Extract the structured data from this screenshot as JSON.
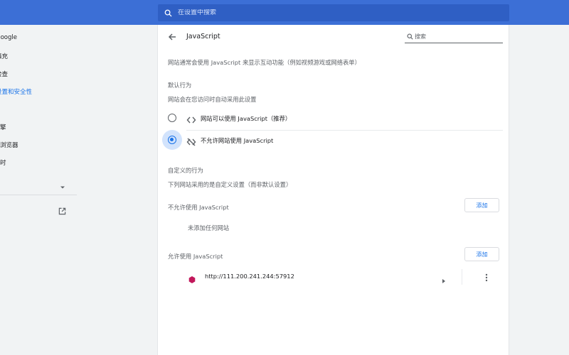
{
  "top_search": {
    "placeholder": "在设置中搜索"
  },
  "sidebar": {
    "items": [
      {
        "label": "Google"
      },
      {
        "label": "填充"
      },
      {
        "label": "检查"
      },
      {
        "label": "设置和安全性"
      },
      {
        "label": "擎"
      },
      {
        "label": "浏览器"
      },
      {
        "label": "时"
      }
    ]
  },
  "page": {
    "title": "JavaScript",
    "search_placeholder": "搜索",
    "description": "网站通常会使用 JavaScript 来显示互动功能（例如视频游戏或网络表单）",
    "default_behavior": {
      "heading": "默认行为",
      "subheading": "网站会在您访问时自动采用此设置",
      "options": [
        {
          "label": "网站可以使用 JavaScript（推荐）",
          "checked": false
        },
        {
          "label": "不允许网站使用 JavaScript",
          "checked": true
        }
      ]
    },
    "custom_behavior": {
      "heading": "自定义的行为",
      "subheading": "下列网站采用的是自定义设置（而非默认设置）"
    },
    "block_list": {
      "heading": "不允许使用 JavaScript",
      "add_label": "添加",
      "empty_text": "未添加任何网站"
    },
    "allow_list": {
      "heading": "允许使用 JavaScript",
      "add_label": "添加",
      "sites": [
        {
          "url": "http://111.200.241.244:57912",
          "favicon_color": "#c2185b"
        }
      ]
    }
  }
}
